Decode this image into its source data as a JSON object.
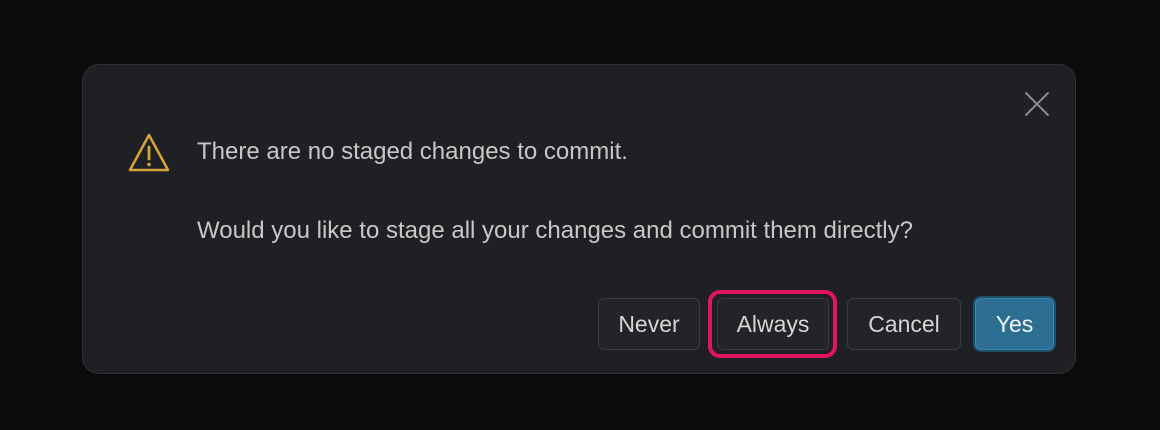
{
  "dialog": {
    "message": "There are no staged changes to commit.",
    "detail": "Would you like to stage all your changes and commit them directly?",
    "warning_color": "#d7a437",
    "highlight_color": "#e0155c",
    "icons": {
      "warning": "warning-icon",
      "close": "close-icon"
    },
    "buttons": {
      "never": "Never",
      "always": "Always",
      "cancel": "Cancel",
      "yes": "Yes"
    },
    "primary_color": "#2d6f93"
  }
}
